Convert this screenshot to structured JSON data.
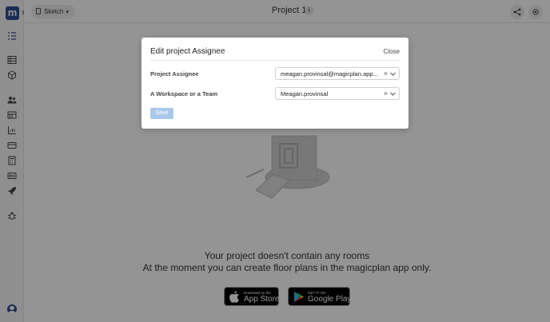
{
  "app": {
    "logo_text": "m",
    "brand_color": "#2d4f8f"
  },
  "header": {
    "view_label": "Sketch",
    "project_title": "Project 1",
    "info_glyph": "i",
    "share_icon": "share-icon",
    "settings_icon": "gear-icon"
  },
  "sidebar": {
    "items": [
      {
        "icon": "list-checks-icon"
      },
      {
        "icon": "table-icon"
      },
      {
        "icon": "cube-icon"
      },
      {
        "icon": "users-icon"
      },
      {
        "icon": "floor-plan-icon"
      },
      {
        "icon": "chart-icon"
      },
      {
        "icon": "card-icon"
      },
      {
        "icon": "calculator-icon"
      },
      {
        "icon": "id-card-icon"
      },
      {
        "icon": "rocket-icon"
      },
      {
        "icon": "bug-icon"
      }
    ],
    "avatar_icon": "user-avatar-icon"
  },
  "empty_state": {
    "line1": "Your project doesn't contain any rooms",
    "line2": "At the moment you can create floor plans in the magicplan app only.",
    "app_store": {
      "small": "Download on the",
      "big": "App Store"
    },
    "google_play": {
      "small": "GET IT ON",
      "big": "Google Play"
    }
  },
  "modal": {
    "title": "Edit project Assignee",
    "close_label": "Close",
    "fields": [
      {
        "label": "Project Assignee",
        "value": "meagan.provinsal@magicplan.app..."
      },
      {
        "label": "A Workspace or a Team",
        "value": "Meagan.provinsal"
      }
    ],
    "clear_glyph": "×",
    "save_label": "Save",
    "save_color": "#a9c9ec"
  }
}
